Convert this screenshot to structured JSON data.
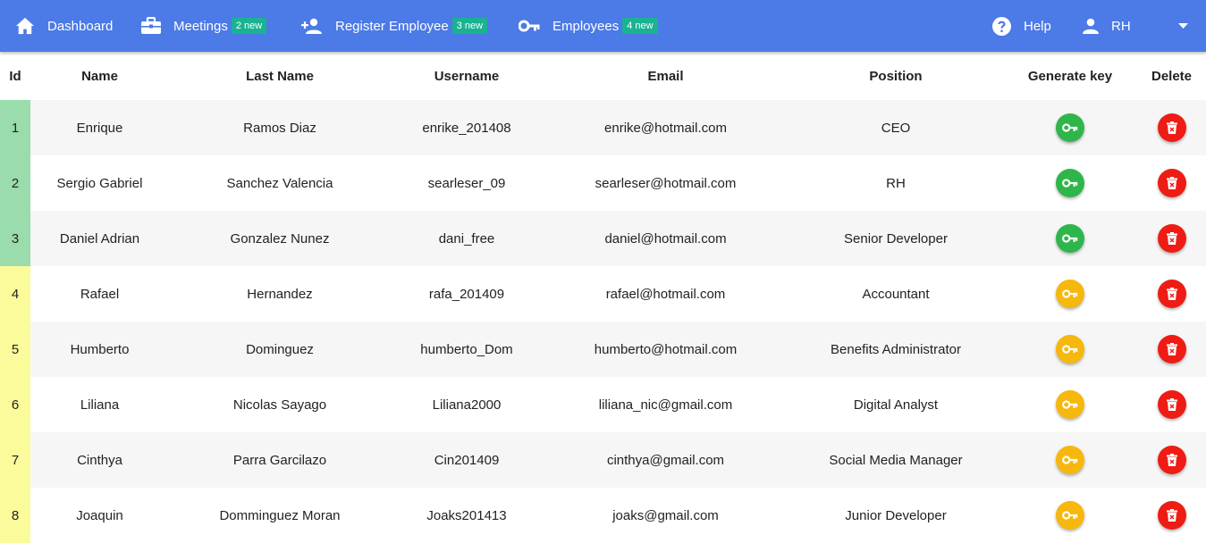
{
  "nav": {
    "dashboard": {
      "label": "Dashboard",
      "icon": "home-icon"
    },
    "meetings": {
      "label": "Meetings",
      "badge": "2 new",
      "icon": "briefcase-icon"
    },
    "register": {
      "label": "Register Employee",
      "badge": "3 new",
      "icon": "person-add-icon"
    },
    "employees": {
      "label": "Employees",
      "badge": "4 new",
      "icon": "key-icon"
    },
    "help": {
      "label": "Help",
      "icon": "help-icon"
    },
    "user": {
      "label": "RH",
      "icon": "person-icon"
    }
  },
  "table": {
    "headers": {
      "id": "Id",
      "name": "Name",
      "last_name": "Last Name",
      "username": "Username",
      "email": "Email",
      "position": "Position",
      "generate_key": "Generate key",
      "delete": "Delete"
    },
    "rows": [
      {
        "id": "1",
        "name": "Enrique",
        "last_name": "Ramos Diaz",
        "username": "enrike_201408",
        "email": "enrike@hotmail.com",
        "position": "CEO",
        "status": "green"
      },
      {
        "id": "2",
        "name": "Sergio Gabriel",
        "last_name": "Sanchez Valencia",
        "username": "searleser_09",
        "email": "searleser@hotmail.com",
        "position": "RH",
        "status": "green"
      },
      {
        "id": "3",
        "name": "Daniel Adrian",
        "last_name": "Gonzalez Nunez",
        "username": "dani_free",
        "email": "daniel@hotmail.com",
        "position": "Senior Developer",
        "status": "green"
      },
      {
        "id": "4",
        "name": "Rafael",
        "last_name": "Hernandez",
        "username": "rafa_201409",
        "email": "rafael@hotmail.com",
        "position": "Accountant",
        "status": "yellow"
      },
      {
        "id": "5",
        "name": "Humberto",
        "last_name": "Dominguez",
        "username": "humberto_Dom",
        "email": "humberto@hotmail.com",
        "position": "Benefits Administrator",
        "status": "yellow"
      },
      {
        "id": "6",
        "name": "Liliana",
        "last_name": "Nicolas Sayago",
        "username": "Liliana2000",
        "email": "liliana_nic@gmail.com",
        "position": "Digital Analyst",
        "status": "yellow"
      },
      {
        "id": "7",
        "name": "Cinthya",
        "last_name": "Parra Garcilazo",
        "username": "Cin201409",
        "email": "cinthya@gmail.com",
        "position": "Social Media Manager",
        "status": "yellow"
      },
      {
        "id": "8",
        "name": "Joaquin",
        "last_name": "Domminguez Moran",
        "username": "Joaks201413",
        "email": "joaks@gmail.com",
        "position": "Junior Developer",
        "status": "yellow"
      }
    ]
  },
  "colors": {
    "topbar": "#4c7ae6",
    "badge": "#19b392",
    "key_green": "#2fb64a",
    "key_yellow": "#f6b80c",
    "delete_red": "#ee1c14",
    "id_green": "#9adcab",
    "id_yellow": "#fbfb9b"
  }
}
